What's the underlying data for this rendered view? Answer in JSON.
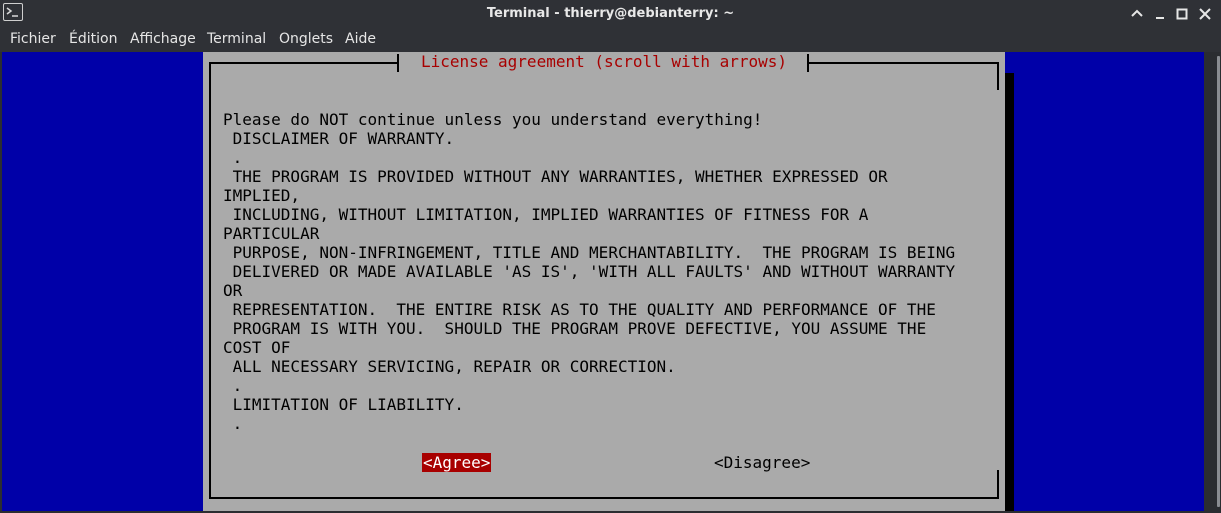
{
  "window": {
    "title": "Terminal - thierry@debianterry: ~"
  },
  "menu": [
    {
      "label": "Fichier"
    },
    {
      "label": "Édition"
    },
    {
      "label": "Affichage"
    },
    {
      "label": "Terminal"
    },
    {
      "label": "Onglets"
    },
    {
      "label": "Aide"
    }
  ],
  "dialog": {
    "title": "License agreement (scroll with arrows)",
    "text_lines": [
      "Please do NOT continue unless you understand everything!",
      " DISCLAIMER OF WARRANTY.",
      " .",
      " THE PROGRAM IS PROVIDED WITHOUT ANY WARRANTIES, WHETHER EXPRESSED OR",
      "IMPLIED,",
      " INCLUDING, WITHOUT LIMITATION, IMPLIED WARRANTIES OF FITNESS FOR A",
      "PARTICULAR",
      " PURPOSE, NON-INFRINGEMENT, TITLE AND MERCHANTABILITY.  THE PROGRAM IS BEING",
      " DELIVERED OR MADE AVAILABLE 'AS IS', 'WITH ALL FAULTS' AND WITHOUT WARRANTY",
      "OR",
      " REPRESENTATION.  THE ENTIRE RISK AS TO THE QUALITY AND PERFORMANCE OF THE",
      " PROGRAM IS WITH YOU.  SHOULD THE PROGRAM PROVE DEFECTIVE, YOU ASSUME THE",
      "COST OF",
      " ALL NECESSARY SERVICING, REPAIR OR CORRECTION.",
      " .",
      " LIMITATION OF LIABILITY.",
      " ."
    ],
    "agree_label": "<Agree>",
    "disagree_label": "<Disagree>",
    "selected_button": "agree"
  },
  "colors": {
    "terminal_bg": "#0000a8",
    "dialog_bg": "#aaaaaa",
    "title_text": "#a80000",
    "selected_button_bg": "#a80000",
    "titlebar_bg": "#2f3136"
  },
  "icons": {
    "app": "terminal-icon",
    "minimize": "minimize-icon",
    "maximize": "maximize-icon",
    "close": "close-icon",
    "roll_up": "chevron-up-icon"
  }
}
